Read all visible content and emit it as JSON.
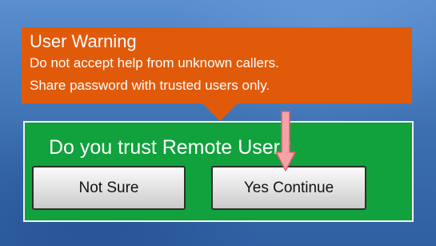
{
  "warning": {
    "title": "User Warning",
    "line1": "Do not accept help from unknown callers.",
    "line2": "Share password with trusted users only."
  },
  "prompt": {
    "question": "Do you trust Remote User?",
    "not_sure_label": "Not Sure",
    "yes_label": "Yes Continue"
  },
  "colors": {
    "warning_bg": "#e15a0a",
    "prompt_bg": "#11a13d",
    "desktop_bg": "#3f74b6",
    "arrow": "#f5a3a9"
  },
  "icons": {
    "arrow": "down-arrow-icon"
  }
}
